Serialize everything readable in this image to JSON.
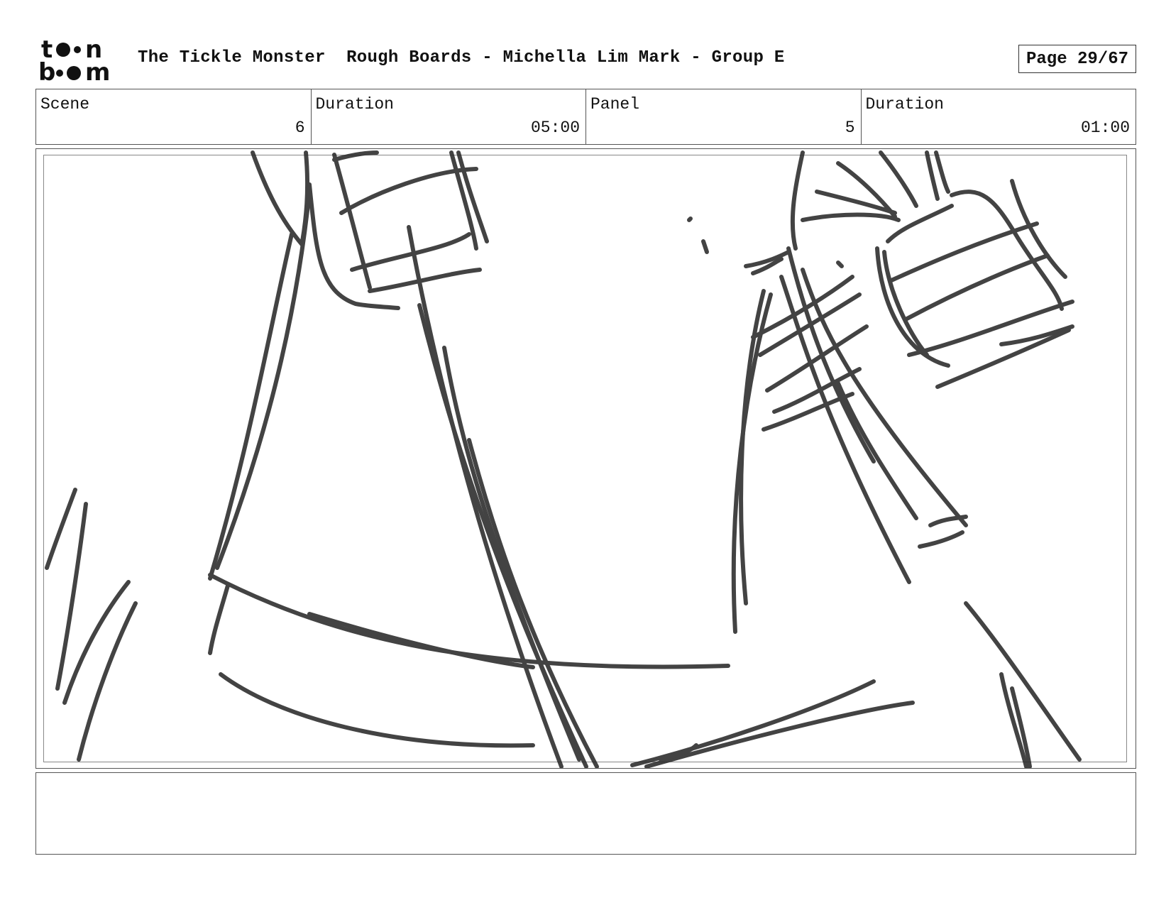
{
  "header": {
    "logo_icon": "toon-boom-logo",
    "project_title": "The Tickle Monster",
    "board_info": "Rough Boards - Michella Lim Mark - Group E",
    "page_label": "Page 29/67"
  },
  "info": {
    "scene_label": "Scene",
    "scene_value": "6",
    "scene_duration_label": "Duration",
    "scene_duration_value": "05:00",
    "panel_label": "Panel",
    "panel_value": "5",
    "panel_duration_label": "Duration",
    "panel_duration_value": "01:00"
  },
  "panel": {
    "sketch": "rough-pencil-sketch"
  },
  "notes": {
    "text": ""
  }
}
